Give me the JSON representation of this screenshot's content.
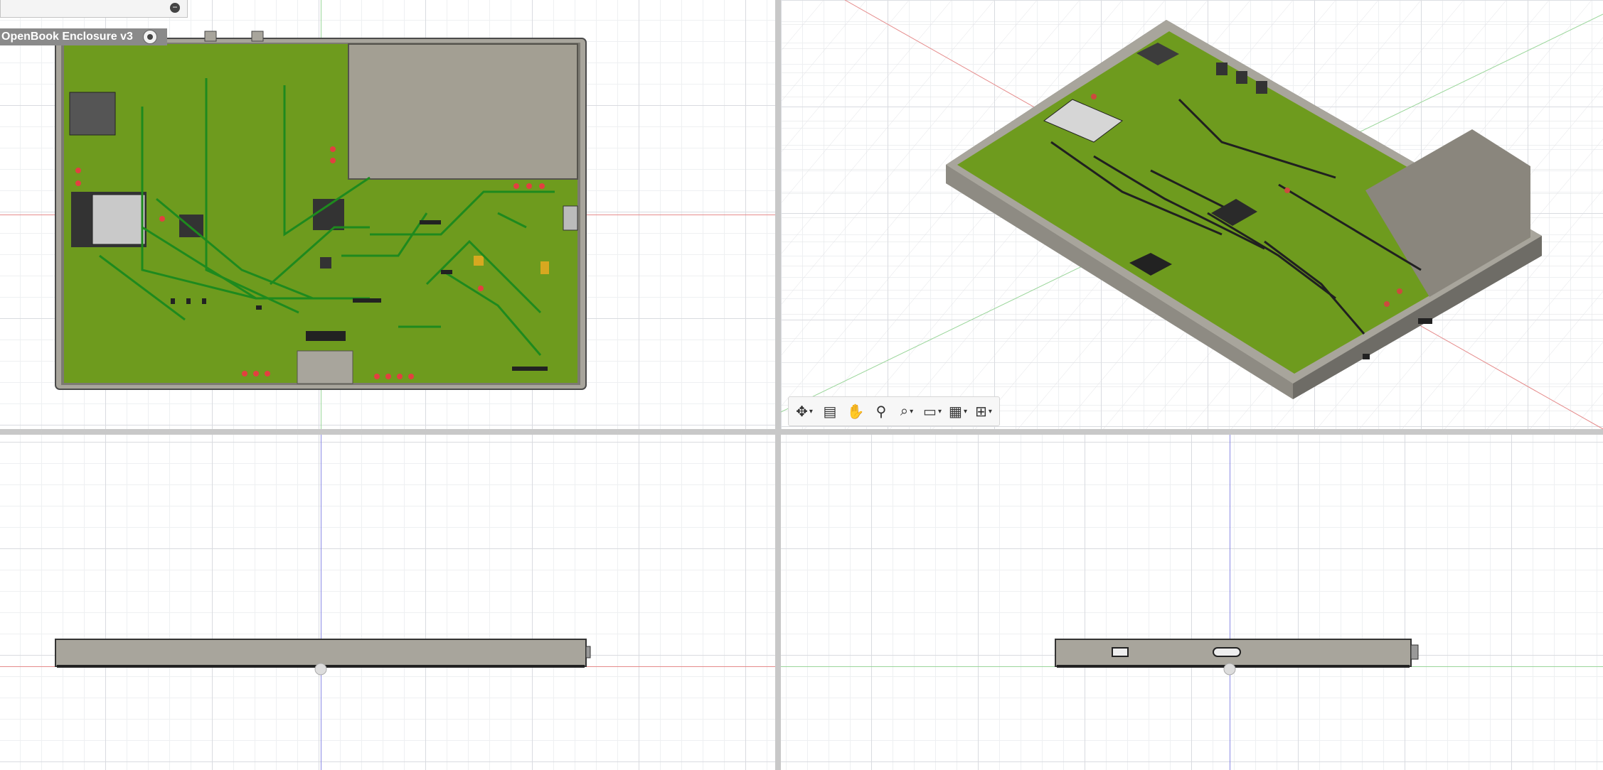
{
  "browser": {
    "document_label": "OpenBook Enclosure v3",
    "collapse_icon": "minus-circle-icon",
    "visibility_icon": "radio-visibility-icon"
  },
  "viewports": [
    "top",
    "home",
    "front",
    "right"
  ],
  "nav_bar": {
    "tools": [
      {
        "name": "orbit-icon",
        "glyph": "✥",
        "dropdown": true
      },
      {
        "name": "look-at-icon",
        "glyph": "▤",
        "dropdown": false
      },
      {
        "name": "pan-icon",
        "glyph": "✋",
        "dropdown": false
      },
      {
        "name": "zoom-icon",
        "glyph": "🔍",
        "dropdown": false
      },
      {
        "name": "fit-zoom-icon",
        "glyph": "⌕",
        "dropdown": true
      },
      {
        "name": "display-settings-icon",
        "glyph": "🖵",
        "dropdown": true
      },
      {
        "name": "grid-settings-icon",
        "glyph": "▦",
        "dropdown": true
      },
      {
        "name": "viewports-icon",
        "glyph": "⊞",
        "dropdown": true
      }
    ]
  },
  "colors": {
    "pcb": "#6e9b1e",
    "trace": "#1e8a1e",
    "enclosure": "#a8a59c",
    "enclosure_dark": "#5e5c56",
    "display": "#a39f93",
    "axis_red": "#e58a8a",
    "axis_green": "#9ad69a",
    "axis_blue": "#8a8ae5"
  }
}
